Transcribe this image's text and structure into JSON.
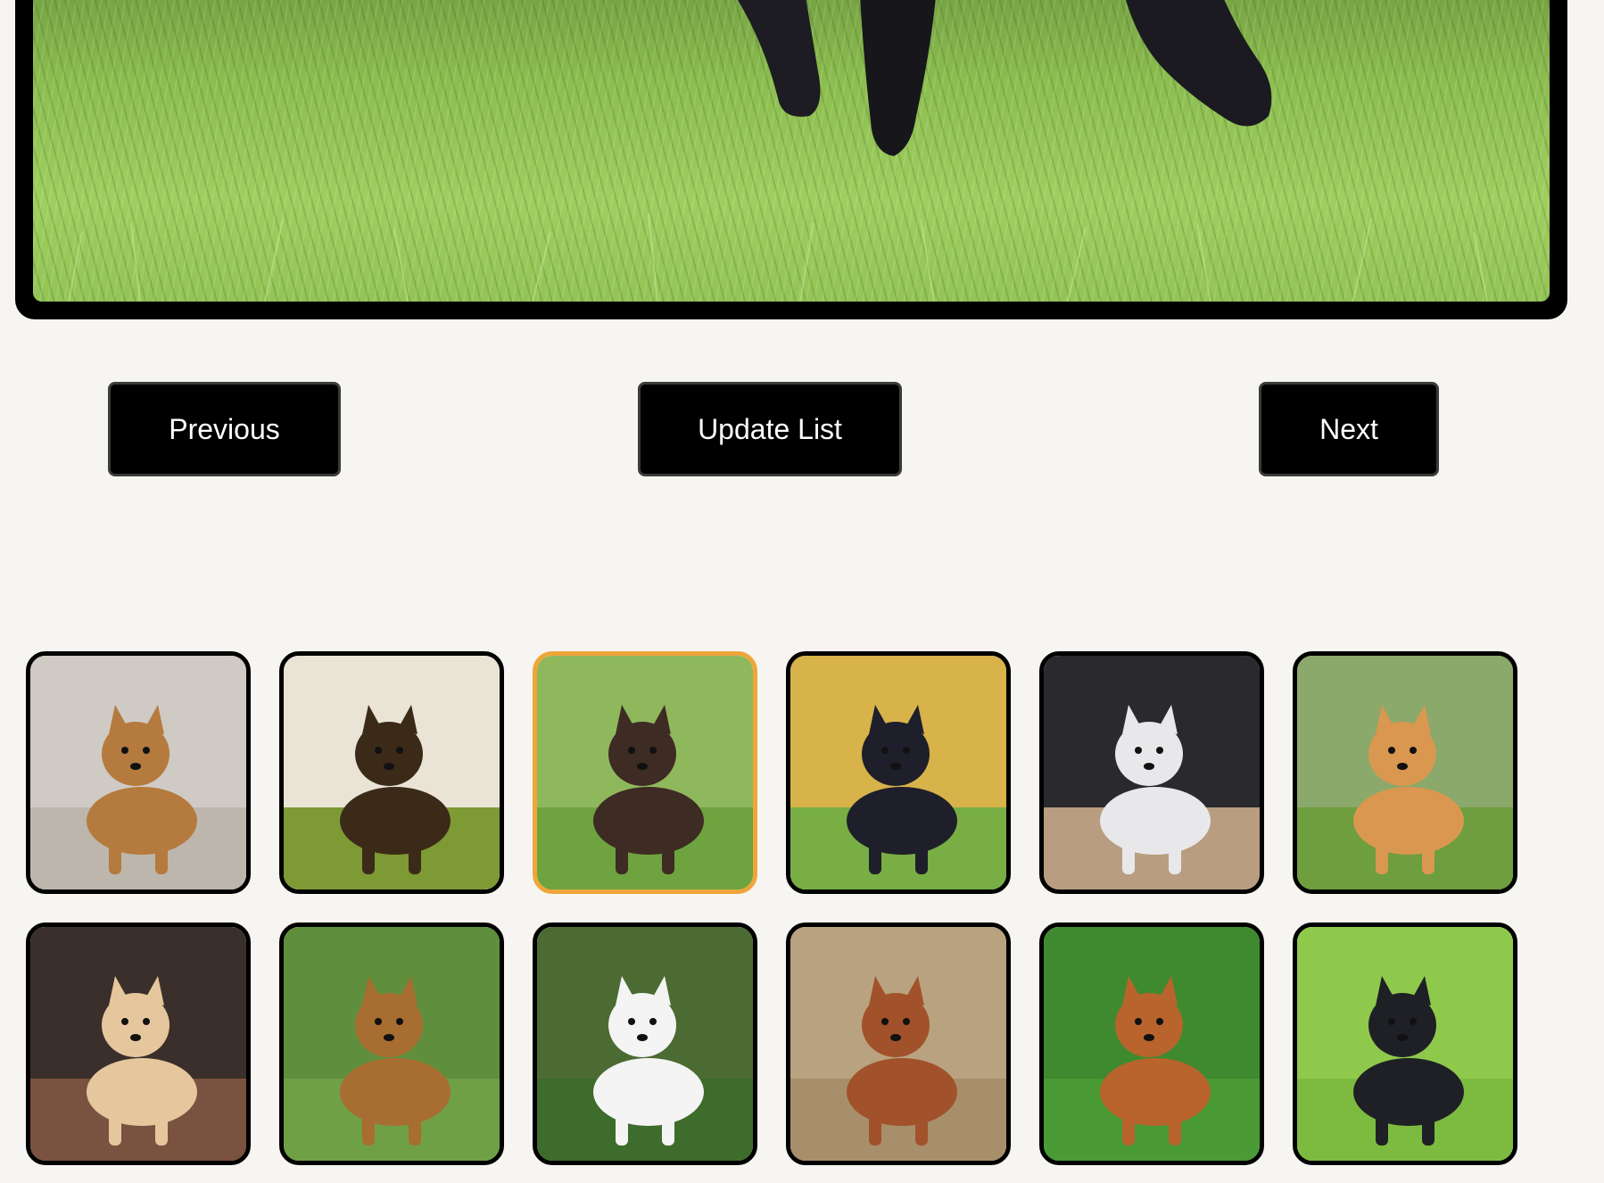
{
  "controls": {
    "previous_label": "Previous",
    "update_label": "Update List",
    "next_label": "Next"
  },
  "viewer": {
    "icon": "dog-photo",
    "background_color": "#8cbd4f",
    "subject_color": "#1c1c22"
  },
  "thumbnails": [
    {
      "id": "labradoodle",
      "selected": false,
      "bg": "#cfcac4",
      "fg": "#b57a3e",
      "ground": "#bdb6ad"
    },
    {
      "id": "german-shepherd",
      "selected": false,
      "bg": "#e9e4d6",
      "fg": "#3b2a18",
      "ground": "#7d9a34"
    },
    {
      "id": "chocolate-lab",
      "selected": true,
      "bg": "#8fb85c",
      "fg": "#3e2b24",
      "ground": "#6ea33f"
    },
    {
      "id": "french-bulldog",
      "selected": false,
      "bg": "#d7b34a",
      "fg": "#1e1f2a",
      "ground": "#78ae44"
    },
    {
      "id": "husky",
      "selected": false,
      "bg": "#2a2a2e",
      "fg": "#e8e8ea",
      "ground": "#b89d80"
    },
    {
      "id": "pomeranian",
      "selected": false,
      "bg": "#8aa96a",
      "fg": "#d99750",
      "ground": "#6e9e3e"
    },
    {
      "id": "chihuahua",
      "selected": false,
      "bg": "#3a2f2a",
      "fg": "#e6c79d",
      "ground": "#7a5240"
    },
    {
      "id": "airedale",
      "selected": false,
      "bg": "#5f8e3c",
      "fg": "#a86d30",
      "ground": "#6fa046"
    },
    {
      "id": "poodle",
      "selected": false,
      "bg": "#4c6b33",
      "fg": "#f4f4f4",
      "ground": "#3d6c2c"
    },
    {
      "id": "basenji",
      "selected": false,
      "bg": "#b9a27f",
      "fg": "#a1522a",
      "ground": "#a88f6b"
    },
    {
      "id": "brittany",
      "selected": false,
      "bg": "#3f8a2f",
      "fg": "#b8642c",
      "ground": "#4a9a35"
    },
    {
      "id": "newfoundland",
      "selected": false,
      "bg": "#8fc94b",
      "fg": "#1f2026",
      "ground": "#7dbb40"
    }
  ]
}
